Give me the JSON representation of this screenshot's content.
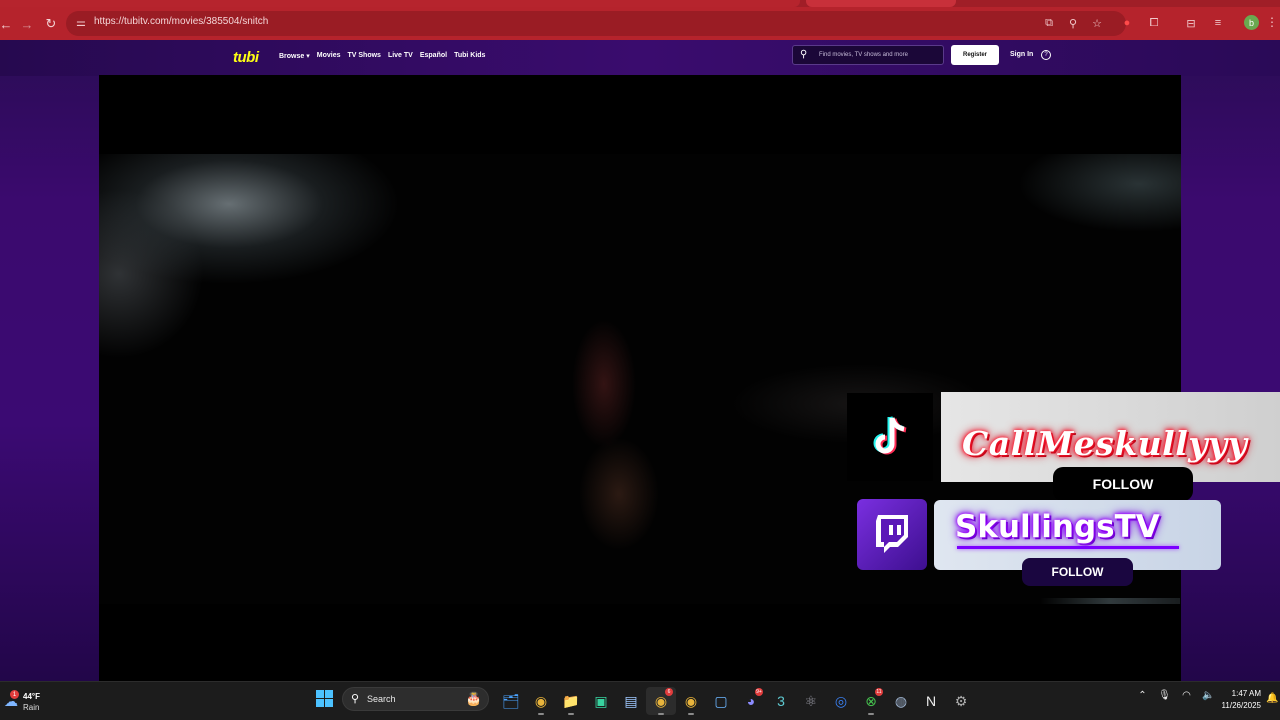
{
  "browser": {
    "url": "https://tubitv.com/movies/385504/snitch",
    "nav": {
      "back_icon": "back-arrow-icon",
      "forward_icon": "forward-arrow-icon",
      "reload_icon": "reload-icon"
    },
    "url_icons": [
      "cast-icon",
      "zoom-icon",
      "star-icon"
    ],
    "extension_icons": [
      "record-icon",
      "puzzle-icon",
      "sidebar-icon",
      "media-icon"
    ],
    "profile_initial": "b",
    "accent": "#b5232c"
  },
  "site": {
    "logo": "tubi",
    "menu": [
      "Browse ▾",
      "Movies",
      "TV Shows",
      "Live TV",
      "Español",
      "Tubi Kids"
    ],
    "search_placeholder": "Find movies, TV shows and more",
    "register": "Register",
    "sign_in": "Sign In",
    "help": "?"
  },
  "overlays": {
    "tiktok": {
      "handle": "CallMeskullyyy",
      "follow": "FOLLOW",
      "icon": "tiktok-icon"
    },
    "twitch": {
      "handle": "SkullingsTV",
      "follow": "FOLLOW",
      "icon": "twitch-icon"
    }
  },
  "taskbar": {
    "weather": {
      "temp": "44°F",
      "condition": "Rain",
      "badge": "1"
    },
    "search_label": "Search",
    "apps": [
      {
        "name": "file-explorer-icon",
        "glyph": "🗂",
        "badges": ""
      },
      {
        "name": "chrome-icon",
        "glyph": "◉",
        "badges": ""
      },
      {
        "name": "folder-icon",
        "glyph": "📁",
        "badges": ""
      },
      {
        "name": "tv-app-icon",
        "glyph": "▣",
        "badges": ""
      },
      {
        "name": "notepad-icon",
        "glyph": "▤",
        "badges": ""
      },
      {
        "name": "chrome-profile-icon",
        "glyph": "◉",
        "badges": "6"
      },
      {
        "name": "chrome-alt-icon",
        "glyph": "◉",
        "badges": ""
      },
      {
        "name": "store-icon",
        "glyph": "▢",
        "badges": ""
      },
      {
        "name": "discord-icon",
        "glyph": "◕",
        "badges": "9+"
      },
      {
        "name": "app-three-icon",
        "glyph": "3",
        "badges": ""
      },
      {
        "name": "react-icon",
        "glyph": "⚛",
        "badges": ""
      },
      {
        "name": "app-circle-icon",
        "glyph": "◎",
        "badges": ""
      },
      {
        "name": "xbox-icon",
        "glyph": "⊗",
        "badges": "11"
      },
      {
        "name": "steam-icon",
        "glyph": "◍",
        "badges": ""
      },
      {
        "name": "notion-icon",
        "glyph": "N",
        "badges": ""
      },
      {
        "name": "settings-icon",
        "glyph": "⚙",
        "badges": ""
      }
    ],
    "tray": [
      "chevron-up-icon",
      "mic-icon",
      "wifi-icon",
      "volume-icon"
    ],
    "time": "1:47 AM",
    "date": "11/26/2025"
  }
}
